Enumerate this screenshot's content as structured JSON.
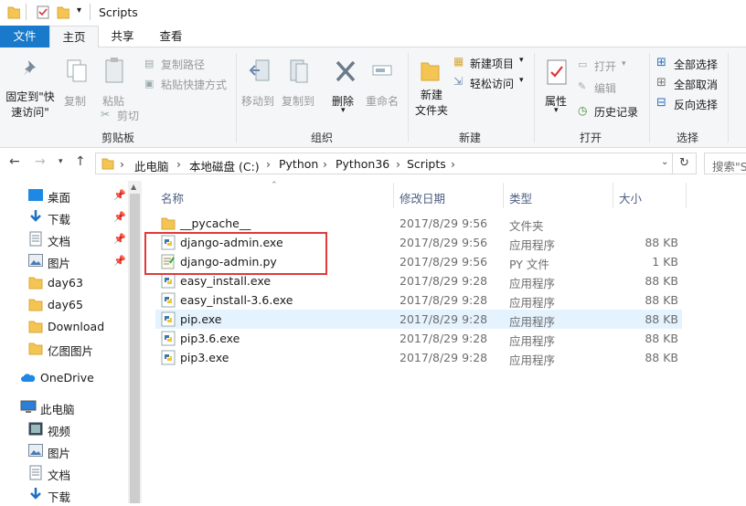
{
  "title": "Scripts",
  "tabs": [
    "文件",
    "主页",
    "共享",
    "查看"
  ],
  "ribbon": {
    "clipboard": {
      "pin": "固定到\"快\n速访问\"",
      "copy": "复制",
      "paste": "粘贴",
      "copy_path": "复制路径",
      "paste_shortcut": "粘贴快捷方式",
      "cut": "剪切",
      "label": "剪贴板"
    },
    "organize": {
      "move_to": "移动到",
      "copy_to": "复制到",
      "delete": "删除",
      "rename": "重命名",
      "label": "组织"
    },
    "new": {
      "new_folder": "新建\n文件夹",
      "new_item": "新建项目",
      "easy_access": "轻松访问",
      "label": "新建"
    },
    "open": {
      "properties": "属性",
      "open": "打开",
      "edit": "编辑",
      "history": "历史记录",
      "label": "打开"
    },
    "select": {
      "select_all": "全部选择",
      "select_none": "全部取消",
      "invert": "反向选择",
      "label": "选择"
    }
  },
  "address": {
    "crumbs": [
      "此电脑",
      "本地磁盘 (C:)",
      "Python",
      "Python36",
      "Scripts"
    ],
    "search_placeholder": "搜索\"S"
  },
  "nav": {
    "quick": [
      {
        "label": "桌面",
        "icon": "desktop-icon",
        "pinned": true
      },
      {
        "label": "下载",
        "icon": "download-icon",
        "pinned": true
      },
      {
        "label": "文档",
        "icon": "document-icon",
        "pinned": true
      },
      {
        "label": "图片",
        "icon": "pictures-icon",
        "pinned": true
      },
      {
        "label": "day63",
        "icon": "folder-icon",
        "pinned": false
      },
      {
        "label": "day65",
        "icon": "folder-icon",
        "pinned": false
      },
      {
        "label": "Download",
        "icon": "folder-icon",
        "pinned": false
      },
      {
        "label": "亿图图片",
        "icon": "folder-icon",
        "pinned": false
      }
    ],
    "onedrive": "OneDrive",
    "thispc": "此电脑",
    "pc_items": [
      {
        "label": "视频",
        "icon": "video-icon"
      },
      {
        "label": "图片",
        "icon": "pictures-icon"
      },
      {
        "label": "文档",
        "icon": "document-icon"
      },
      {
        "label": "下载",
        "icon": "download-icon"
      }
    ]
  },
  "columns": {
    "name": "名称",
    "date": "修改日期",
    "type": "类型",
    "size": "大小"
  },
  "files": [
    {
      "name": "__pycache__",
      "date": "2017/8/29 9:56",
      "type": "文件夹",
      "size": "",
      "icon": "folder-icon"
    },
    {
      "name": "django-admin.exe",
      "date": "2017/8/29 9:56",
      "type": "应用程序",
      "size": "88 KB",
      "icon": "python-exe-icon"
    },
    {
      "name": "django-admin.py",
      "date": "2017/8/29 9:56",
      "type": "PY 文件",
      "size": "1 KB",
      "icon": "python-script-icon"
    },
    {
      "name": "easy_install.exe",
      "date": "2017/8/29 9:28",
      "type": "应用程序",
      "size": "88 KB",
      "icon": "python-exe-icon"
    },
    {
      "name": "easy_install-3.6.exe",
      "date": "2017/8/29 9:28",
      "type": "应用程序",
      "size": "88 KB",
      "icon": "python-exe-icon"
    },
    {
      "name": "pip.exe",
      "date": "2017/8/29 9:28",
      "type": "应用程序",
      "size": "88 KB",
      "icon": "python-exe-icon"
    },
    {
      "name": "pip3.6.exe",
      "date": "2017/8/29 9:28",
      "type": "应用程序",
      "size": "88 KB",
      "icon": "python-exe-icon"
    },
    {
      "name": "pip3.exe",
      "date": "2017/8/29 9:28",
      "type": "应用程序",
      "size": "88 KB",
      "icon": "python-exe-icon"
    }
  ],
  "selected_file": "pip.exe",
  "highlighted_files": [
    "django-admin.exe",
    "django-admin.py"
  ],
  "colors": {
    "accent": "#1979ca",
    "selection": "#e5f3ff",
    "highlight_box": "#e03a3a",
    "folder": "#f4c553"
  }
}
